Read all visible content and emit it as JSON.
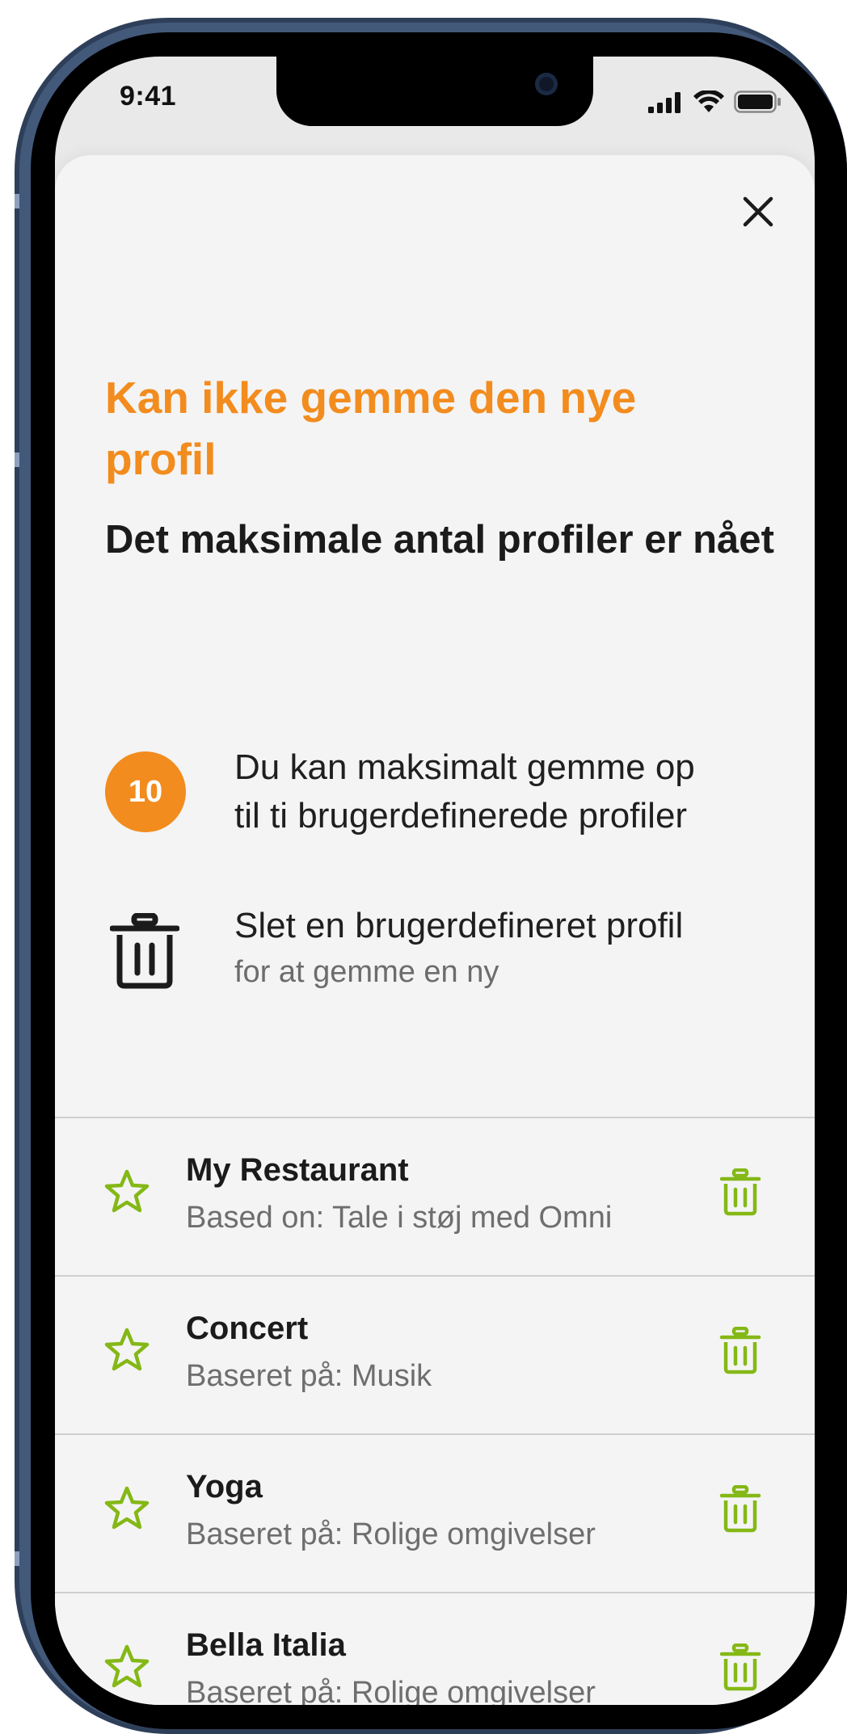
{
  "status_bar": {
    "time": "9:41"
  },
  "dialog": {
    "title": "Kan ikke gemme den nye profil",
    "subtitle": "Det maksimale antal profiler er nået",
    "info_limit": {
      "badge": "10",
      "text_line1": "Du kan maksimalt gemme op",
      "text_line2": "til ti brugerdefinerede profiler"
    },
    "info_delete": {
      "text": "Slet en brugerdefineret profil",
      "subtext": "for at gemme en ny"
    }
  },
  "profiles": [
    {
      "name": "My Restaurant",
      "based_on": "Based on: Tale i støj med Omni"
    },
    {
      "name": "Concert",
      "based_on": "Baseret på: Musik"
    },
    {
      "name": "Yoga",
      "based_on": "Baseret på: Rolige omgivelser"
    },
    {
      "name": "Bella Italia",
      "based_on": "Baseret på: Rolige omgivelser"
    }
  ],
  "colors": {
    "accent_orange": "#f28c1e",
    "accent_green": "#84b816",
    "text_dark": "#1b1b1b",
    "text_muted": "#6e6e6e",
    "sheet_bg": "#f4f4f4",
    "phone_frame": "#43597a"
  },
  "icons": {
    "close": "close-icon",
    "trash": "trash-icon",
    "star": "star-icon",
    "signal": "signal-icon",
    "wifi": "wifi-icon",
    "battery": "battery-icon"
  }
}
